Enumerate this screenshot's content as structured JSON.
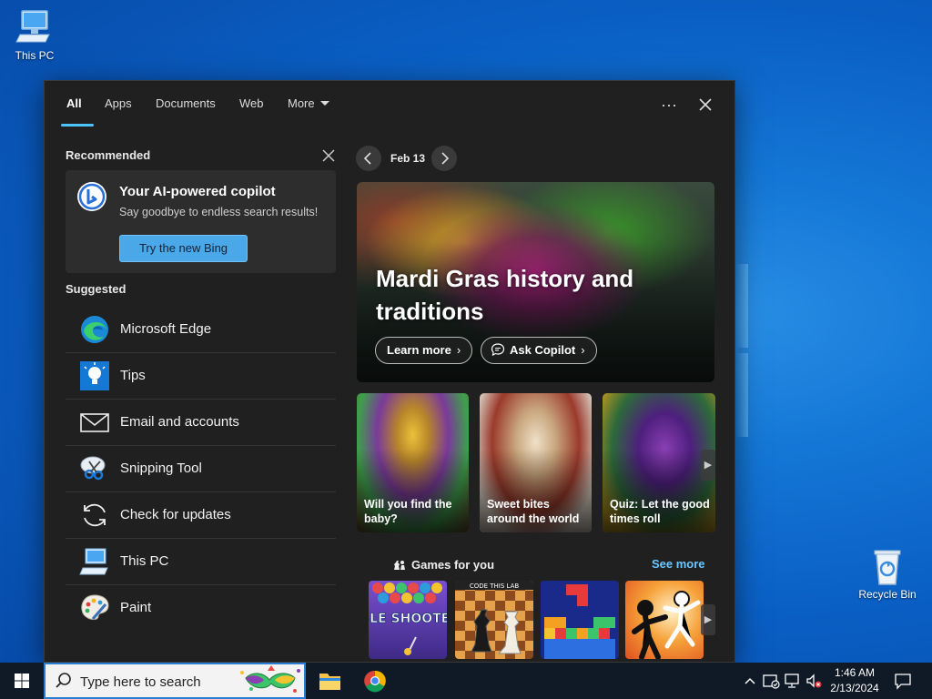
{
  "desktop": {
    "this_pc_label": "This PC",
    "recycle_bin_label": "Recycle Bin"
  },
  "tabs": [
    {
      "label": "All",
      "active": true
    },
    {
      "label": "Apps"
    },
    {
      "label": "Documents"
    },
    {
      "label": "Web"
    },
    {
      "label": "More"
    }
  ],
  "header": {
    "ellipsis": "···",
    "close": "✕"
  },
  "recommended": {
    "title": "Recommended",
    "card_title": "Your AI-powered copilot",
    "card_subtitle": "Say goodbye to endless search results!",
    "button_label": "Try the new Bing"
  },
  "suggested": {
    "title": "Suggested",
    "items": [
      {
        "label": "Microsoft Edge",
        "icon": "edge-icon"
      },
      {
        "label": "Tips",
        "icon": "tips-icon"
      },
      {
        "label": "Email and accounts",
        "icon": "mail-icon"
      },
      {
        "label": "Snipping Tool",
        "icon": "snipping-icon"
      },
      {
        "label": "Check for updates",
        "icon": "refresh-icon"
      },
      {
        "label": "This PC",
        "icon": "computer-icon"
      },
      {
        "label": "Paint",
        "icon": "paint-icon"
      }
    ]
  },
  "highlights": {
    "date": "Feb 13",
    "hero_title": "Mardi Gras history and traditions",
    "learn_more": "Learn more",
    "ask_copilot": "Ask Copilot",
    "cards": [
      {
        "caption": "Will you find the baby?"
      },
      {
        "caption": "Sweet bites around the world"
      },
      {
        "caption": "Quiz: Let the good times roll"
      }
    ],
    "games_title": "Games for you",
    "see_more": "See more",
    "game_tiles": [
      {
        "label": "BUBBLE SHOOTER HD"
      },
      {
        "label": "CODE THIS LAB"
      }
    ]
  },
  "taskbar": {
    "search_placeholder": "Type here to search",
    "time": "1:46 AM",
    "date": "2/13/2024"
  },
  "colors": {
    "accent": "#4cc2ff",
    "panel_bg": "#202020",
    "link": "#6cc6ff",
    "bing_button": "#4aa8e8"
  }
}
